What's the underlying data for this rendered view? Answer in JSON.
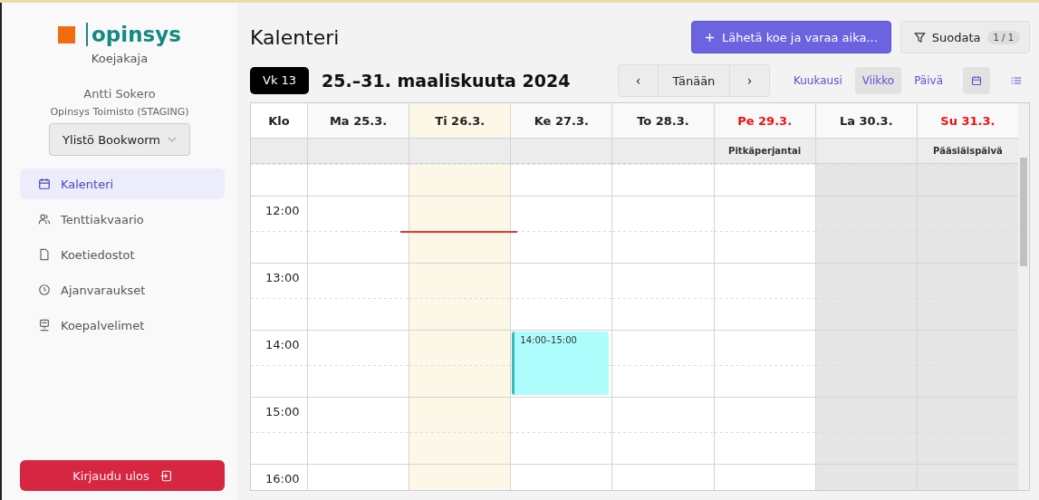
{
  "sidebar": {
    "logo": "opinsys",
    "app_name": "Koejakaja",
    "user": "Antti Sokero",
    "organization": "Opinsys Toimisto (STAGING)",
    "school_select": {
      "value": "Ylistö Bookworm"
    },
    "items": [
      {
        "label": "Kalenteri",
        "selected": true
      },
      {
        "label": "Tenttiakvaario",
        "selected": false
      },
      {
        "label": "Koetiedostot",
        "selected": false
      },
      {
        "label": "Ajanvaraukset",
        "selected": false
      },
      {
        "label": "Koepalvelimet",
        "selected": false
      }
    ],
    "logout": "Kirjaudu ulos"
  },
  "header": {
    "title": "Kalenteri",
    "primary_button": "Lähetä koe ja varaa aika...",
    "filter_button": "Suodata",
    "filter_count": "1 / 1"
  },
  "toolbar": {
    "week": "Vk 13",
    "range": "25.–31. maaliskuuta 2024",
    "prev": "‹",
    "today": "Tänään",
    "next": "›",
    "views": [
      {
        "label": "Kuukausi",
        "selected": false
      },
      {
        "label": "Viikko",
        "selected": true
      },
      {
        "label": "Päivä",
        "selected": false
      }
    ],
    "modes": [
      {
        "selected": true
      },
      {
        "selected": false
      }
    ]
  },
  "calendar": {
    "time_header": "Klo",
    "days": [
      {
        "label": "Ma 25.3.",
        "holiday": false,
        "today": false,
        "weekend": false
      },
      {
        "label": "Ti 26.3.",
        "holiday": false,
        "today": true,
        "weekend": false,
        "now_line": true
      },
      {
        "label": "Ke 27.3.",
        "holiday": false,
        "today": false,
        "weekend": false,
        "slots": [
          {
            "kind": "free"
          },
          {
            "kind": "free"
          },
          {
            "kind": "event",
            "text": "14:00–15:00"
          },
          {
            "kind": "free"
          },
          {
            "kind": "free"
          }
        ]
      },
      {
        "label": "To 28.3.",
        "holiday": false,
        "today": false,
        "weekend": false
      },
      {
        "label": "Pe 29.3.",
        "holiday": true,
        "holiday_name": "Pitkäperjantai",
        "today": false,
        "weekend": false
      },
      {
        "label": "La 30.3.",
        "holiday": false,
        "today": false,
        "weekend": true
      },
      {
        "label": "Su 31.3.",
        "holiday": true,
        "holiday_name": "Pääsiäispäivä",
        "today": false,
        "weekend": true
      }
    ],
    "hours": [
      "12:00",
      "13:00",
      "14:00",
      "15:00",
      "16:00"
    ]
  }
}
